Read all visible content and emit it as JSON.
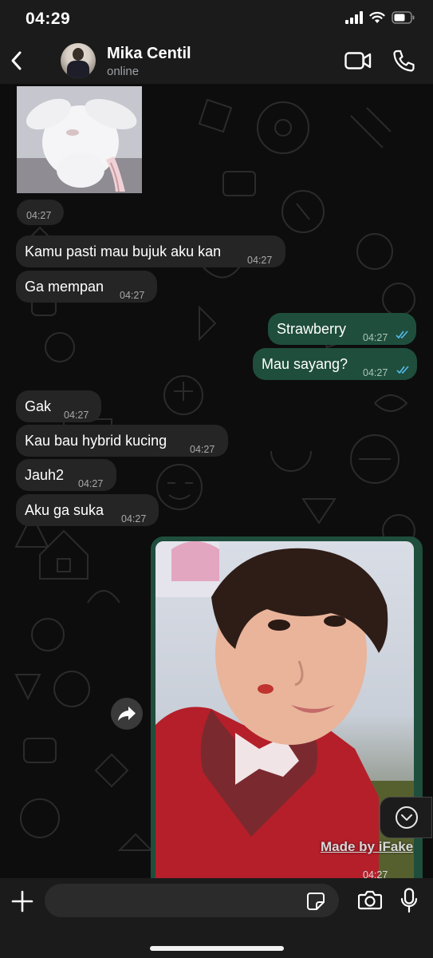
{
  "status_bar": {
    "time": "04:29"
  },
  "header": {
    "contact_name": "Mika Centil",
    "contact_status": "online"
  },
  "messages": [
    {
      "direction": "in",
      "type": "sticker",
      "time": "04:27"
    },
    {
      "direction": "in",
      "type": "text",
      "text": "Kamu pasti mau bujuk aku kan",
      "time": "04:27"
    },
    {
      "direction": "in",
      "type": "text",
      "text": "Ga mempan",
      "time": "04:27"
    },
    {
      "direction": "out",
      "type": "text",
      "text": "Strawberry",
      "time": "04:27",
      "status": "read"
    },
    {
      "direction": "out",
      "type": "text",
      "text": "Mau sayang?",
      "time": "04:27",
      "status": "read"
    },
    {
      "direction": "in",
      "type": "text",
      "text": "Gak",
      "time": "04:27"
    },
    {
      "direction": "in",
      "type": "text",
      "text": "Kau bau hybrid kucing",
      "time": "04:27"
    },
    {
      "direction": "in",
      "type": "text",
      "text": "Jauh2",
      "time": "04:27"
    },
    {
      "direction": "in",
      "type": "text",
      "text": "Aku ga suka",
      "time": "04:27"
    },
    {
      "direction": "out",
      "type": "photo",
      "watermark": "Made by iFake",
      "time": "04:27",
      "status": "read"
    }
  ],
  "input": {
    "placeholder": ""
  },
  "colors": {
    "incoming_bubble": "#252525",
    "outgoing_bubble": "#1f4e3d",
    "read_ticks": "#53bdeb",
    "background": "#0b0b0b"
  }
}
